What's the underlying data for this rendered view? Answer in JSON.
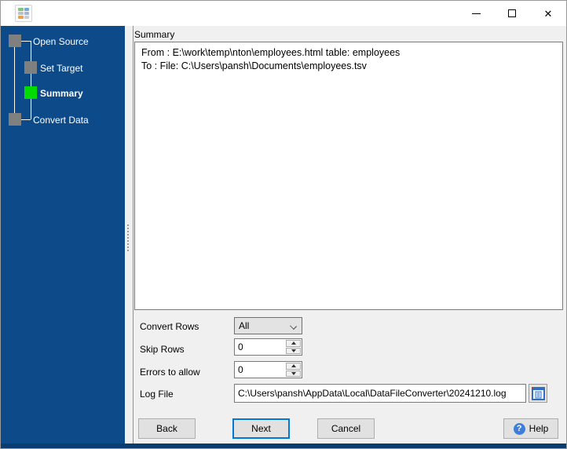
{
  "window": {
    "controls": {
      "minimize_label": "minimize",
      "maximize_label": "maximize",
      "close_icon": "✕"
    }
  },
  "sidebar": {
    "steps": [
      {
        "label": "Open Source",
        "state": "done"
      },
      {
        "label": "Set Target",
        "state": "done"
      },
      {
        "label": "Summary",
        "state": "active"
      },
      {
        "label": "Convert Data",
        "state": "pending"
      }
    ],
    "active_color": "#00db00",
    "inactive_color": "#808080",
    "background_color": "#0d4a8a"
  },
  "main": {
    "section_label": "Summary",
    "summary_lines": [
      "From : E:\\work\\temp\\nton\\employees.html table: employees",
      "To : File: C:\\Users\\pansh\\Documents\\employees.tsv"
    ],
    "form": {
      "convert_rows": {
        "label": "Convert Rows",
        "value": "All"
      },
      "skip_rows": {
        "label": "Skip Rows",
        "value": "0"
      },
      "errors_to_allow": {
        "label": "Errors to allow",
        "value": "0"
      },
      "log_file": {
        "label": "Log File",
        "value": "C:\\Users\\pansh\\AppData\\Local\\DataFileConverter\\20241210.log"
      }
    },
    "buttons": {
      "back": "Back",
      "next": "Next",
      "cancel": "Cancel",
      "help": "Help",
      "help_icon_glyph": "?"
    }
  },
  "colors": {
    "focus_border": "#0078d7",
    "bottom_strip": "#0b3c70"
  }
}
